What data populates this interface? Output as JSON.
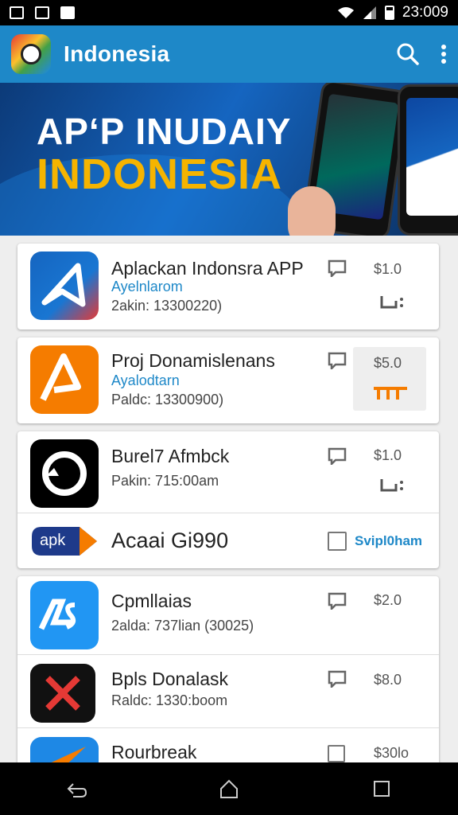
{
  "status_bar": {
    "time": "23:009"
  },
  "appbar": {
    "title": "Indonesia"
  },
  "banner": {
    "line1": "APʻP INUDAIY",
    "line2": "INDONESIA"
  },
  "cards": [
    {
      "title": "Aplackan Indonsra APP",
      "subtitle": "Ayelnlarom",
      "meta": "2akin: 13300220)",
      "price": "$1.0",
      "icon": "blue-arrow-app-icon"
    },
    {
      "title": "Proj Donamislenans",
      "subtitle": "Ayalodtarn",
      "meta": "Paldc: 13300900)",
      "price": "$5.0",
      "icon": "orange-a-app-icon"
    },
    {
      "title": "Burel7 Afmbck",
      "subtitle": "",
      "meta": "Pakin: 715:00am",
      "price": "$1.0",
      "icon": "black-circle-app-icon"
    },
    {
      "title": "Acaai Gi990",
      "subtitle": "",
      "meta": "",
      "price": "Svipl0ham",
      "icon": "apk-icon"
    },
    {
      "title": "Cpmllaias",
      "subtitle": "",
      "meta": "2alda: 737lian (30025)",
      "price": "$2.0",
      "icon": "las-app-icon"
    },
    {
      "title": "Bpls Donalask",
      "subtitle": "",
      "meta": "Raldc: 1330:boom",
      "price": "$8.0",
      "icon": "red-x-app-icon"
    },
    {
      "title": "Rourbreak",
      "subtitle": "",
      "meta": "",
      "price": "$30lo",
      "icon": "paper-plane-app-icon"
    }
  ],
  "colors": {
    "appbar": "#1e88c8",
    "accent_orange": "#f57c00",
    "link_blue": "#1e88c8"
  }
}
